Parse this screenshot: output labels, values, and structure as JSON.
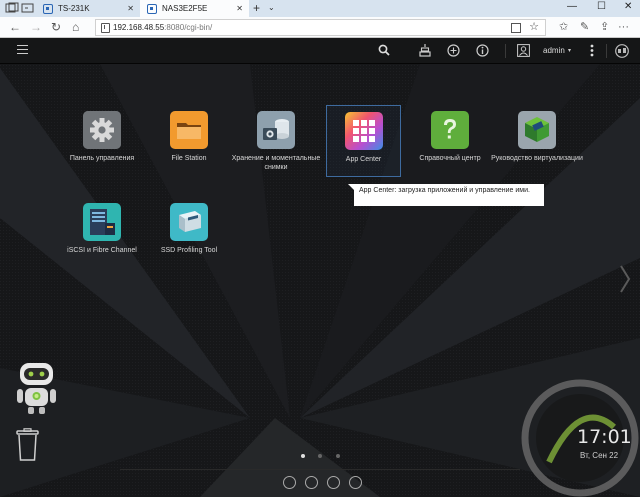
{
  "browser": {
    "tabs": [
      {
        "label": "TS-231K",
        "active": false
      },
      {
        "label": "NAS3E2F5E",
        "active": true
      }
    ],
    "new_tab_glyph": "+",
    "tab_dropdown_glyph": "⌄",
    "window_buttons": {
      "minimize": "—",
      "maximize": "☐",
      "close": "✕"
    },
    "close_tab_glyph": "✕",
    "url_host": "192.168.48.55",
    "url_path": ":8080/cgi-bin/",
    "nav": {
      "back": "←",
      "forward": "→",
      "refresh": "↻",
      "home": "⌂"
    },
    "toolbar": {
      "favorites": "☆",
      "favorites_bar": "✩",
      "share": "⇪",
      "more": "···"
    }
  },
  "qts": {
    "user": "admin",
    "user_caret": "▾",
    "apps": [
      {
        "label": "Панель управления"
      },
      {
        "label": "File Station"
      },
      {
        "label": "Хранение и моментальные снимки"
      },
      {
        "label": "App Center"
      },
      {
        "label": "Справочный центр"
      },
      {
        "label": "Руководство виртуализации"
      },
      {
        "label": "iSCSI и Fibre Channel"
      },
      {
        "label": "SSD Profiling Tool"
      }
    ],
    "tooltip": "App Center: загрузка приложений и управление ими.",
    "clock": "17:01",
    "date": "Вт, Сен 22",
    "current_page": 1,
    "page_count": 3,
    "colors": {
      "desktop_bg": "#141517",
      "selection_border": "#3e6b9f",
      "accent_blue": "#2a66b5"
    }
  }
}
